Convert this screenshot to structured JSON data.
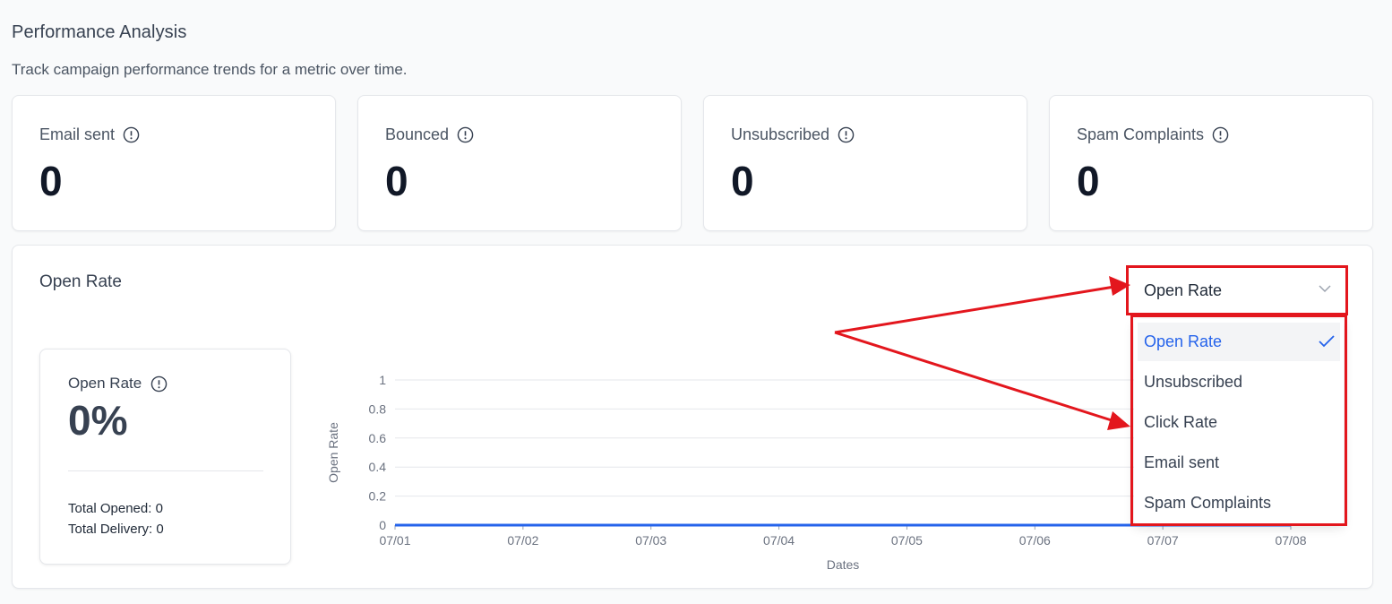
{
  "page": {
    "title": "Performance Analysis",
    "subtitle": "Track campaign performance trends for a metric over time."
  },
  "stats": [
    {
      "label": "Email sent",
      "value": "0",
      "icon": "info-circle-icon"
    },
    {
      "label": "Bounced",
      "value": "0",
      "icon": "info-circle-icon"
    },
    {
      "label": "Unsubscribed",
      "value": "0",
      "icon": "info-circle-icon"
    },
    {
      "label": "Spam Complaints",
      "value": "0",
      "icon": "info-circle-icon"
    }
  ],
  "panel": {
    "title": "Open Rate",
    "summary": {
      "label": "Open Rate",
      "value": "0%",
      "total_opened": "Total Opened: 0",
      "total_delivery": "Total Delivery: 0"
    }
  },
  "metric_select": {
    "value": "Open Rate",
    "options": [
      "Open Rate",
      "Unsubscribed",
      "Click Rate",
      "Email sent",
      "Spam Complaints"
    ],
    "selected_index": 0
  },
  "chart_data": {
    "type": "line",
    "title": "",
    "xlabel": "Dates",
    "ylabel": "Open Rate",
    "x": [
      "07/01",
      "07/02",
      "07/03",
      "07/04",
      "07/05",
      "07/06",
      "07/07",
      "07/08"
    ],
    "y_ticks": [
      "0",
      "0.2",
      "0.4",
      "0.6",
      "0.8",
      "1"
    ],
    "ylim": [
      0,
      1
    ],
    "grid": true,
    "series": [
      {
        "values": [
          0,
          0,
          0,
          0,
          0,
          0,
          0,
          0
        ],
        "color": "#2563eb"
      }
    ]
  },
  "colors": {
    "accent": "#2563eb",
    "annotation": "#e3161d"
  }
}
